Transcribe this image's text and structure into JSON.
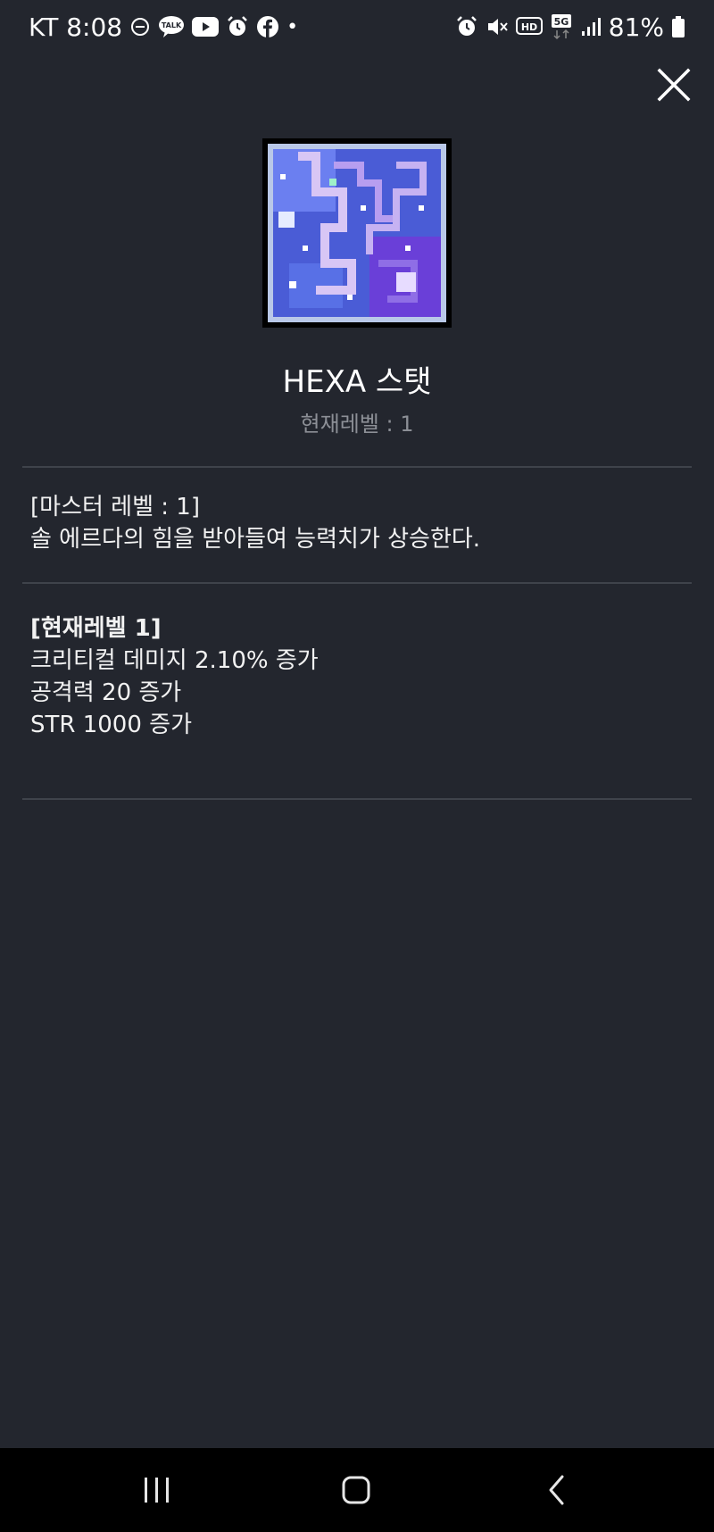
{
  "status_bar": {
    "carrier_time": "KT 8:08",
    "talk_badge": "TALK",
    "hd_badge": "HD",
    "network_badge": "5G",
    "battery": "81%",
    "dot": "•"
  },
  "dialog": {
    "title": "HEXA 스탯",
    "subtitle": "현재레벨 : 1",
    "master_level": "[마스터 레벨 : 1]",
    "description": "솔 에르다의 힘을 받아들여 능력치가 상승한다.",
    "current_level_header": "[현재레벨 1]",
    "effects": [
      "크리티컬 데미지 2.10% 증가",
      "공격력 20 증가",
      "STR 1000 증가"
    ]
  },
  "colors": {
    "background": "#23262e",
    "divider": "#3f434b",
    "subtitle": "#8c8f96",
    "nav_bar": "#000000"
  },
  "icons": {
    "close": "close-icon",
    "skill": "hexa-stat-icon",
    "nav_recent": "recent-apps-icon",
    "nav_home": "home-icon",
    "nav_back": "back-icon"
  }
}
